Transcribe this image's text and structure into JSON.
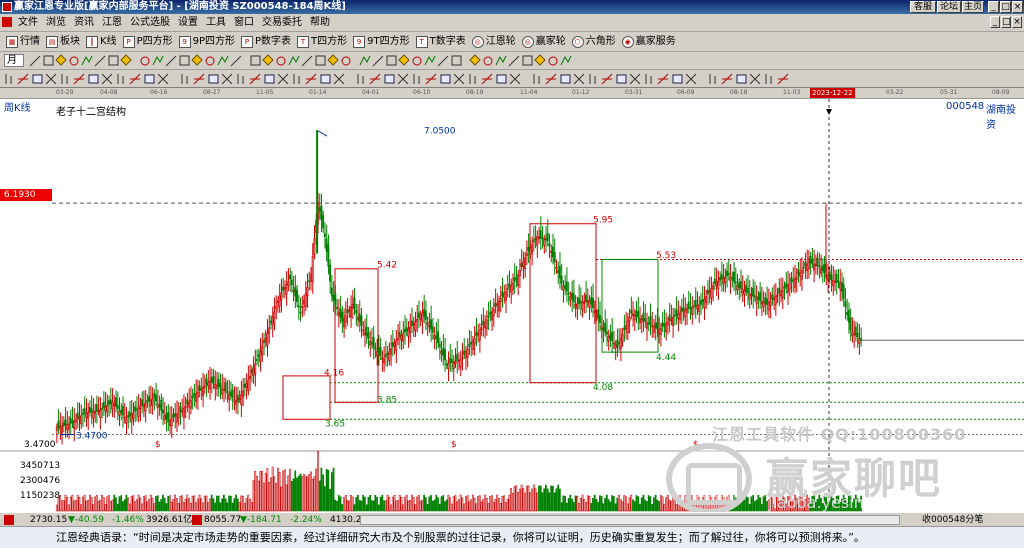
{
  "window": {
    "title": "赢家江恩专业版[赢家内部服务平台] - [湖南投资  SZ000548-184周K线]",
    "buttons": [
      "客服",
      "论坛",
      "主页"
    ]
  },
  "menu": {
    "items": [
      "文件",
      "浏览",
      "资讯",
      "江恩",
      "公式选股",
      "设置",
      "工具",
      "窗口",
      "交易委托",
      "帮助"
    ]
  },
  "toolbar1": {
    "items": [
      {
        "icon": "grid-icon",
        "label": "行情"
      },
      {
        "icon": "blocks-icon",
        "label": "板块"
      },
      {
        "icon": "candle-icon",
        "label": "K线"
      },
      {
        "icon": "square-p-icon",
        "label": "P四方形"
      },
      {
        "icon": "square-9p-icon",
        "label": "9P四方形"
      },
      {
        "icon": "square-pdigit-icon",
        "label": "P数字表"
      },
      {
        "icon": "square-t-icon",
        "label": "T四方形"
      },
      {
        "icon": "square-9t-icon",
        "label": "9T四方形"
      },
      {
        "icon": "square-tn-icon",
        "label": "T数字表"
      },
      {
        "icon": "wheel-icon",
        "label": "江恩轮"
      },
      {
        "icon": "winner-wheel-icon",
        "label": "赢家轮"
      },
      {
        "icon": "hexagon-icon",
        "label": "六角形"
      },
      {
        "icon": "service-icon",
        "label": "赢家服务"
      }
    ]
  },
  "toolbar2": {
    "period": "月"
  },
  "datebar": {
    "dates": [
      "03-29",
      "04-08",
      "06-16",
      "08-27",
      "11-05",
      "01-14",
      "04-01",
      "06-10",
      "08-19",
      "11-04",
      "01-12",
      "03-31",
      "06-09",
      "08-18",
      "11-03",
      "2023-12-22",
      "03-22",
      "05-31",
      "08-09"
    ],
    "cursor_date": "2023-12-22"
  },
  "chart": {
    "period_label": "周K线",
    "pattern_label": "老子十二宫结构",
    "stock_code": "000548",
    "stock_name": "湖南投资",
    "cursor_price": "6.1930",
    "low_axis_label": "3.4700",
    "annotations": [
      "7.0500",
      "5.42",
      "4.16",
      "3.65",
      "3.85",
      "5.95",
      "5.53",
      "4.44",
      "4.08",
      "3.4700"
    ],
    "volume_labels": [
      "3450713",
      "2300476",
      "1150238"
    ],
    "series_colors": {
      "up": "#cc0000",
      "down": "#008000",
      "box_red": "#cc0000",
      "box_green": "#008000"
    }
  },
  "watermark": {
    "software": "江恩工具软件  QQ:100800360",
    "brand": "赢家聊吧",
    "url": "jiaoba.yesin"
  },
  "statusbar": {
    "index1_value": "2730.15",
    "index1_change": "▼-40.59",
    "index1_pct": "-1.46%",
    "index1_amount": "3926.61亿",
    "index2_value": "8055.77",
    "index2_change": "▼-184.71",
    "index2_pct": "-2.24%",
    "index2_amount": "4130.2",
    "right_text": "收000548分笔"
  },
  "quote": {
    "text": "江恩经典语录：“时间是决定市场走势的重要因素，经过详细研究大市及个别股票的过往记录，你将可以证明，历史确实重复发生；而了解过往，你将可以预测将来。”。"
  }
}
